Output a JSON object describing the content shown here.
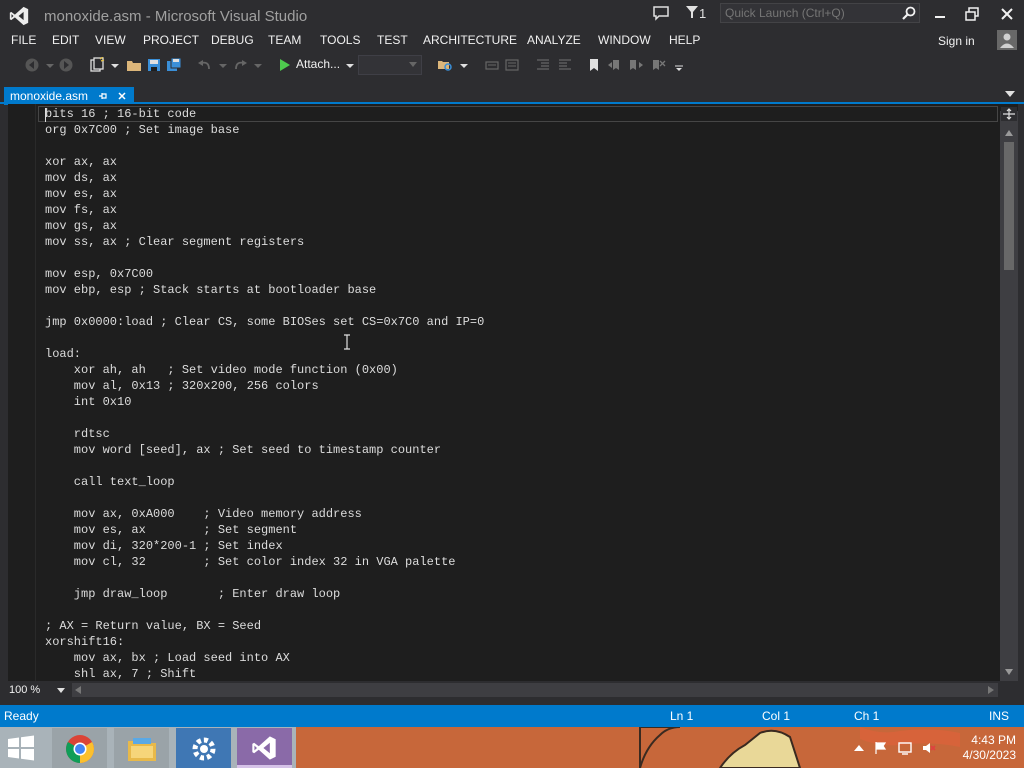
{
  "window": {
    "title": "monoxide.asm - Microsoft Visual Studio",
    "notification_count": "1",
    "quick_launch_placeholder": "Quick Launch (Ctrl+Q)"
  },
  "menu": {
    "items": [
      "FILE",
      "EDIT",
      "VIEW",
      "PROJECT",
      "DEBUG",
      "TEAM",
      "TOOLS",
      "TEST",
      "ARCHITECTURE",
      "ANALYZE",
      "WINDOW",
      "HELP"
    ],
    "sign_in": "Sign in"
  },
  "toolbar": {
    "attach_label": "Attach...",
    "icons": [
      "back-icon",
      "forward-icon",
      "new-project-icon",
      "open-file-icon",
      "save-icon",
      "save-all-icon",
      "undo-icon",
      "redo-icon",
      "start-icon",
      "find-in-files-icon",
      "bookmark-icon"
    ]
  },
  "tab": {
    "label": "monoxide.asm"
  },
  "editor": {
    "lines": [
      "bits 16 ; 16-bit code",
      "org 0x7C00 ; Set image base",
      "",
      "xor ax, ax",
      "mov ds, ax",
      "mov es, ax",
      "mov fs, ax",
      "mov gs, ax",
      "mov ss, ax ; Clear segment registers",
      "",
      "mov esp, 0x7C00",
      "mov ebp, esp ; Stack starts at bootloader base",
      "",
      "jmp 0x0000:load ; Clear CS, some BIOSes set CS=0x7C0 and IP=0",
      "",
      "load:",
      "    xor ah, ah   ; Set video mode function (0x00)",
      "    mov al, 0x13 ; 320x200, 256 colors",
      "    int 0x10",
      "",
      "    rdtsc",
      "    mov word [seed], ax ; Set seed to timestamp counter",
      "",
      "    call text_loop",
      "",
      "    mov ax, 0xA000    ; Video memory address",
      "    mov es, ax        ; Set segment",
      "    mov di, 320*200-1 ; Set index",
      "    mov cl, 32        ; Set color index 32 in VGA palette",
      "",
      "    jmp draw_loop       ; Enter draw loop",
      "",
      "; AX = Return value, BX = Seed",
      "xorshift16:",
      "    mov ax, bx ; Load seed into AX",
      "    shl ax, 7 ; Shift"
    ]
  },
  "zoom": {
    "level": "100 %"
  },
  "status": {
    "state": "Ready",
    "line": "Ln 1",
    "col": "Col 1",
    "ch": "Ch 1",
    "mode": "INS"
  },
  "taskbar": {
    "apps": [
      "chrome-icon",
      "file-explorer-icon",
      "control-panel-icon",
      "visual-studio-icon"
    ],
    "time": "4:43 PM",
    "date": "4/30/2023"
  },
  "colors": {
    "accent": "#007acc",
    "chrome_bg": "#2d2d30",
    "editor_bg": "#1e1e1e",
    "code_text": "#dcdcdc"
  }
}
